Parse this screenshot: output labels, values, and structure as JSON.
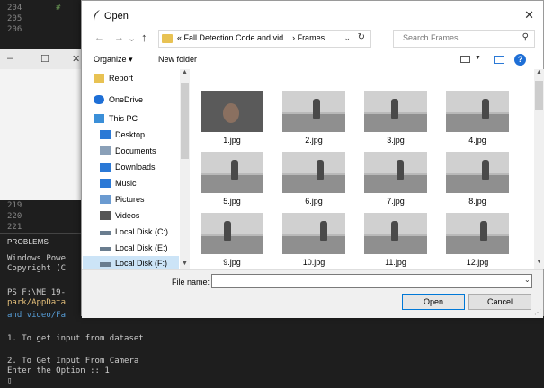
{
  "editor": {
    "lines": [
      {
        "num": "204",
        "text": "#"
      },
      {
        "num": "205",
        "text": ""
      },
      {
        "num": "206",
        "text": ""
      }
    ],
    "lower_lines": [
      "219",
      "220",
      "221"
    ]
  },
  "bg_window": {
    "minimize": "–",
    "maximize": "☐",
    "close": "✕"
  },
  "terminal": {
    "panel_tab": "PROBLEMS",
    "lines": [
      {
        "text": "Windows Powe",
        "color": "#cccccc"
      },
      {
        "text": "Copyright (C",
        "color": "#cccccc"
      },
      {
        "text": "PS F:\\ME 19-",
        "color": "#cccccc"
      },
      {
        "text": "park/AppData",
        "color": "#e5c07b"
      },
      {
        "text": "and video/Fa",
        "color": "#569cd6"
      },
      {
        "text": "1. To get input from dataset",
        "color": "#cccccc"
      },
      {
        "text": "2. To Get Input From Camera",
        "color": "#cccccc"
      },
      {
        "text": "Enter the Option :: 1",
        "color": "#cccccc"
      },
      {
        "text": "▯",
        "color": "#cccccc"
      }
    ]
  },
  "dialog": {
    "title": "Open",
    "close_label": "✕",
    "nav": {
      "back": "←",
      "forward": "→",
      "up": "↑"
    },
    "breadcrumb": "«  Fall Detection Code and vid...  ›  Frames",
    "search_placeholder": "Search Frames",
    "toolbar": {
      "organize": "Organize ▾",
      "new_folder": "New folder"
    },
    "nav_items": [
      {
        "label": "Report",
        "icon": "folder-icon",
        "color": "#e8c253"
      },
      {
        "label": "OneDrive",
        "icon": "cloud-icon",
        "color": "#1e6fd6"
      },
      {
        "label": "This PC",
        "icon": "pc-icon",
        "color": "#3b8fd8"
      },
      {
        "label": "Desktop",
        "icon": "desktop-icon",
        "color": "#2b79d6"
      },
      {
        "label": "Documents",
        "icon": "documents-icon",
        "color": "#8aa0b8"
      },
      {
        "label": "Downloads",
        "icon": "downloads-icon",
        "color": "#2b79d6"
      },
      {
        "label": "Music",
        "icon": "music-icon",
        "color": "#2b79d6"
      },
      {
        "label": "Pictures",
        "icon": "pictures-icon",
        "color": "#6b9bd1"
      },
      {
        "label": "Videos",
        "icon": "videos-icon",
        "color": "#555555"
      },
      {
        "label": "Local Disk (C:)",
        "icon": "disk-icon",
        "color": "#6a7d8f"
      },
      {
        "label": "Local Disk (E:)",
        "icon": "disk-icon",
        "color": "#6a7d8f"
      },
      {
        "label": "Local Disk (F:)",
        "icon": "disk-icon",
        "color": "#6a7d8f"
      }
    ],
    "files": [
      "1.jpg",
      "2.jpg",
      "3.jpg",
      "4.jpg",
      "5.jpg",
      "6.jpg",
      "7.jpg",
      "8.jpg",
      "9.jpg",
      "10.jpg",
      "11.jpg",
      "12.jpg"
    ],
    "file_name_label": "File name:",
    "file_name_value": "",
    "open_label": "Open",
    "cancel_label": "Cancel"
  }
}
